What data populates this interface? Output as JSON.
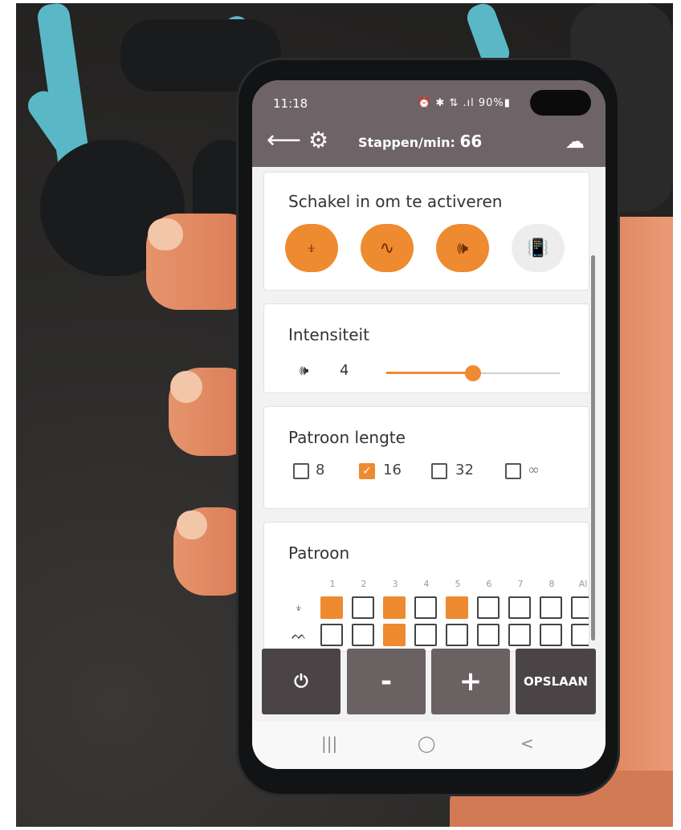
{
  "status_bar": {
    "time": "11:18",
    "icons": "⏰ ✱ ⇅ .ıl 90%▮",
    "battery": "90%"
  },
  "app_bar": {
    "back_icon": "arrow-left",
    "settings_icon": "gear",
    "steps_label": "Stappen/min:",
    "steps_value": "66",
    "cloud_icon": "cloud"
  },
  "activate_card": {
    "title": "Schakel in om te activeren",
    "buttons": [
      {
        "name": "impact",
        "glyph": "⍖",
        "active": true
      },
      {
        "name": "wave",
        "glyph": "∿",
        "active": true
      },
      {
        "name": "sound",
        "glyph": "🕪",
        "active": true
      },
      {
        "name": "vibrate",
        "glyph": "📳",
        "active": false
      }
    ]
  },
  "intensity_card": {
    "title": "Intensiteit",
    "value": "4",
    "level_fraction": 0.5
  },
  "pattern_length_card": {
    "title": "Patroon lengte",
    "options": [
      {
        "label": "8",
        "checked": false
      },
      {
        "label": "16",
        "checked": true
      },
      {
        "label": "32",
        "checked": false
      },
      {
        "label": "∞",
        "checked": false
      }
    ]
  },
  "pattern_card": {
    "title": "Patroon",
    "columns": [
      "1",
      "2",
      "3",
      "4",
      "5",
      "6",
      "7",
      "8",
      "Al"
    ],
    "rows": [
      {
        "icon": "impact",
        "cells": [
          true,
          false,
          true,
          false,
          true,
          false,
          false,
          false,
          false
        ]
      },
      {
        "icon": "wave",
        "cells": [
          false,
          false,
          true,
          false,
          false,
          false,
          false,
          false,
          false
        ]
      }
    ]
  },
  "action_bar": {
    "power_icon": "power",
    "minus_label": "-",
    "plus_label": "+",
    "save_label": "OPSLAAN"
  },
  "nav_bar": {
    "recents": "|||",
    "home": "◯",
    "back": "<"
  },
  "colors": {
    "accent": "#ee8a30",
    "header": "#6e6467",
    "action_dark": "#4b4446",
    "action_mid": "#6a6163"
  }
}
